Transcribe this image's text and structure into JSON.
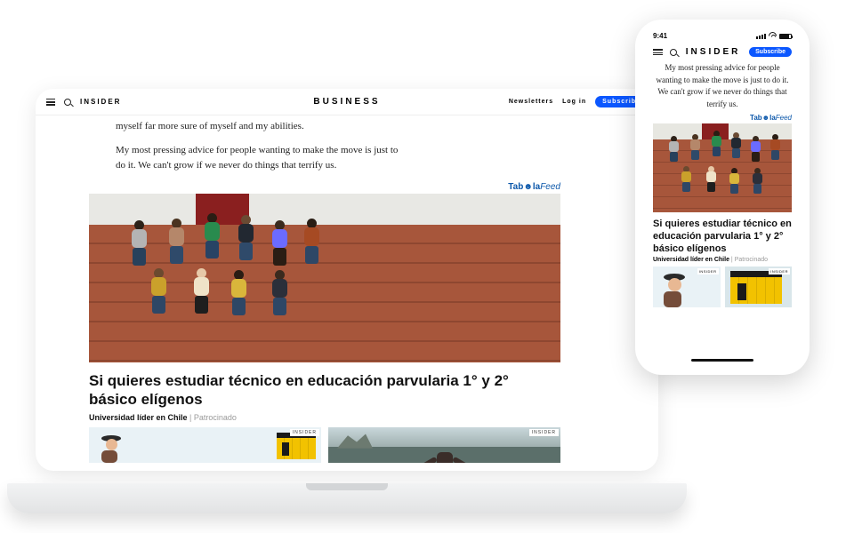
{
  "laptop": {
    "nav": {
      "brand": "INSIDER",
      "section": "BUSINESS",
      "newsletters": "Newsletters",
      "login": "Log in",
      "subscribe": "Subscribe"
    },
    "article": {
      "p1": "myself far more sure of myself and my abilities.",
      "p2": "My most pressing advice for people wanting to make the move is just to do it. We can't grow if we never do things that terrify us."
    },
    "taboola": {
      "brand": "Tab☻la",
      "feed": "Feed"
    },
    "ad": {
      "title": "Si quieres estudiar técnico en educación parvularia 1° y 2° básico elígenos",
      "source": "Universidad líder en Chile",
      "tag": "Patrocinado",
      "thumb_badge": "INSIDER"
    }
  },
  "phone": {
    "status": {
      "time": "9:41"
    },
    "nav": {
      "brand": "INSIDER",
      "subscribe": "Subscribe"
    },
    "article": {
      "p1": "My most pressing advice for people wanting to make the move is just to do it. We can't grow if we never do things that terrify us."
    },
    "taboola": {
      "brand": "Tab☻la",
      "feed": "Feed"
    },
    "ad": {
      "title": "Si quieres estudiar técnico en educación parvularia 1° y 2° básico elígenos",
      "source": "Universidad líder en Chile",
      "tag": "Patrocinado",
      "thumb_badge": "INSIDER"
    }
  }
}
